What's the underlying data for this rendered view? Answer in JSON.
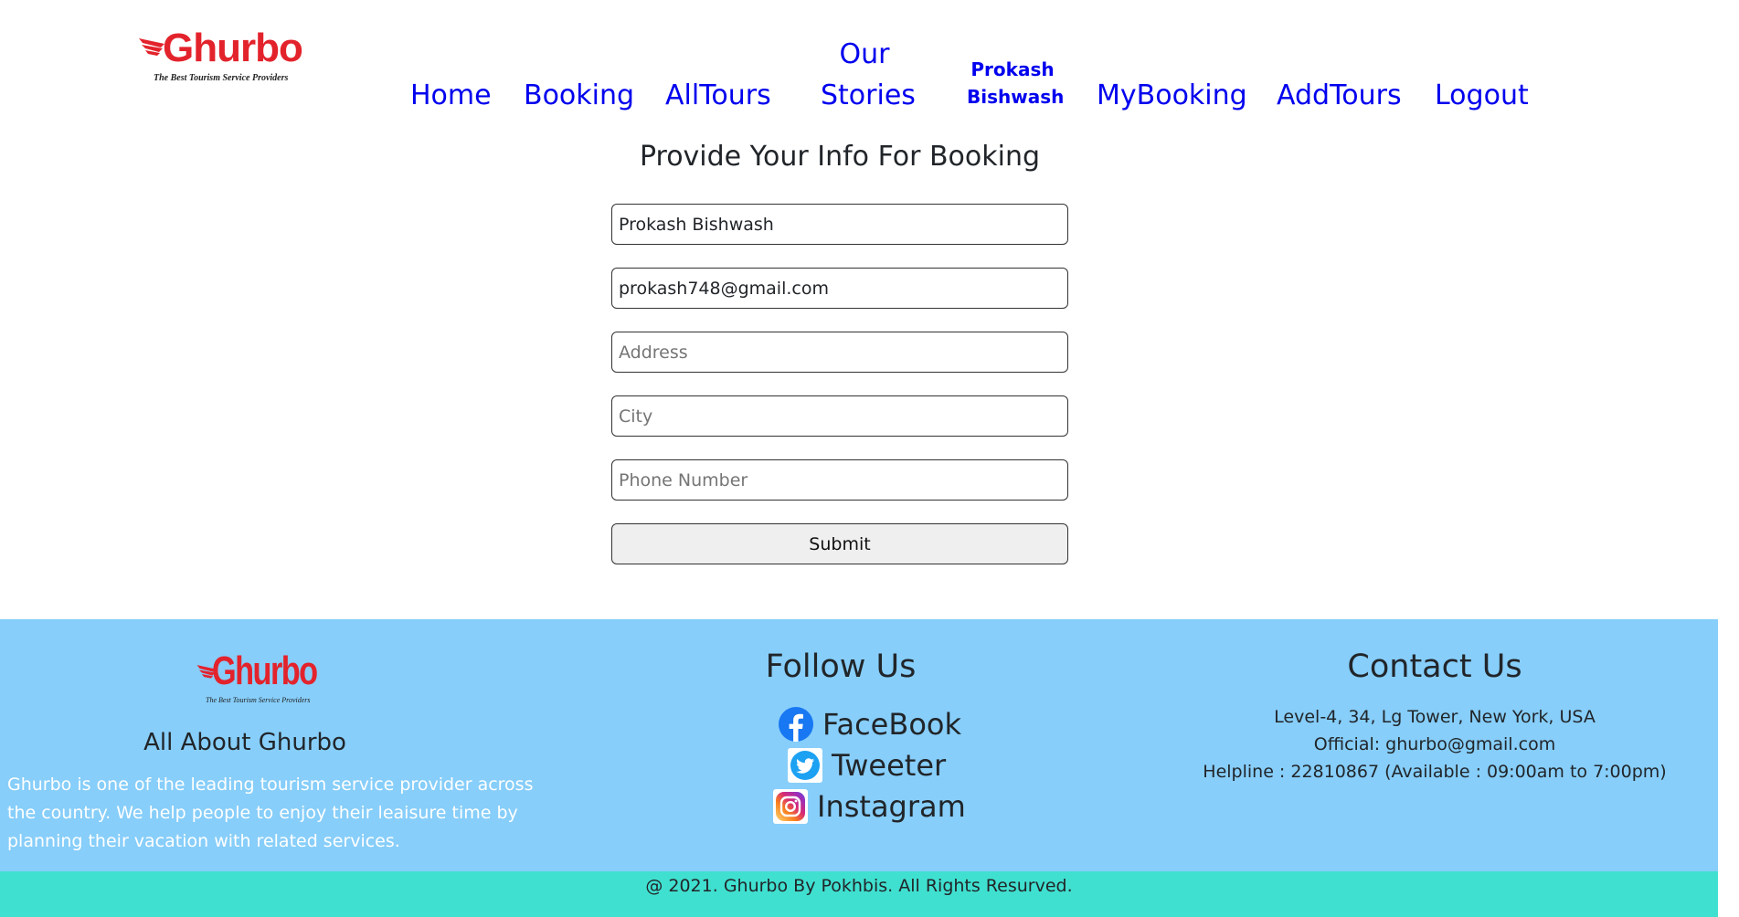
{
  "brand": {
    "logo_word": "Ghurbo",
    "logo_tagline": "The Best Tourism Service Providers",
    "color": "#e3232c"
  },
  "nav": {
    "home": "Home",
    "booking": "Booking",
    "alltours": "AllTours",
    "our_stories_line1": "Our",
    "our_stories_line2": "Stories",
    "user_line1": "Prokash",
    "user_line2": "Bishwash",
    "mybooking": "MyBooking",
    "addtours": "AddTours",
    "logout": "Logout",
    "link_color": "#0000ee"
  },
  "form": {
    "title": "Provide Your Info For Booking",
    "name_value": "Prokash Bishwash",
    "email_value": "prokash748@gmail.com",
    "address_placeholder": "Address",
    "city_placeholder": "City",
    "phone_placeholder": "Phone Number",
    "submit_label": "Submit"
  },
  "footer": {
    "background": "#87cefa",
    "about_title": "All About Ghurbo",
    "about_text": "Ghurbo is one of the leading tourism service provider across the country. We help people to enjoy their leaisure time by planning their vacation with related services.",
    "follow_title": "Follow Us",
    "social": [
      {
        "label": "FaceBook",
        "icon": "facebook-icon"
      },
      {
        "label": "Tweeter",
        "icon": "twitter-icon"
      },
      {
        "label": "Instagram",
        "icon": "instagram-icon"
      }
    ],
    "contact_title": "Contact Us",
    "contact_address": "Level-4, 34, Lg Tower, New York, USA",
    "contact_official": "Official: ghurbo@gmail.com",
    "contact_helpline": "Helpline : 22810867 (Available : 09:00am to 7:00pm)"
  },
  "copyright": {
    "text": "@ 2021. Ghurbo By Pokhbis. All Rights Resurved.",
    "background": "#40e0d0"
  }
}
